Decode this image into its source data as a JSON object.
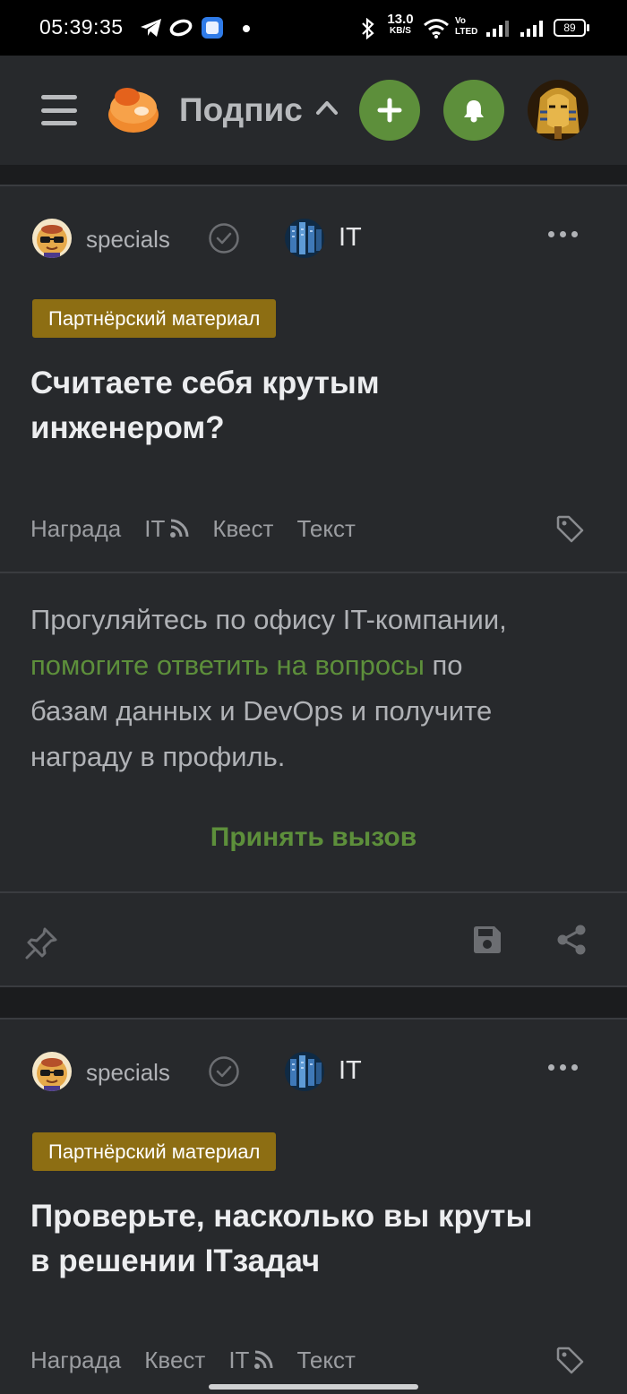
{
  "status_bar": {
    "time": "05:39:35",
    "net_speed_value": "13.0",
    "net_speed_unit": "KB/S",
    "volte": "Vo LTED",
    "battery": "89"
  },
  "header": {
    "title": "Подпис",
    "add_icon": "plus-icon",
    "notifications_icon": "bell-icon",
    "accent_color": "#5d8f3b"
  },
  "posts": [
    {
      "author": "specials",
      "community": "IT",
      "badge": "Партнёрский материал",
      "title_line1": "Считаете себя крутым",
      "title_line2": "инженером?",
      "tags": [
        "Награда",
        "IT",
        "Квест",
        "Текст"
      ],
      "body_start": "Прогуляйтесь по офису IT-компании,",
      "body_link": "помогите ответить на вопросы",
      "body_mid": " по",
      "body_line3": "базам данных и DevOps и получите",
      "body_line4": "награду в профиль.",
      "cta": "Принять вызов"
    },
    {
      "author": "specials",
      "community": "IT",
      "badge": "Партнёрский материал",
      "title_line1": "Проверьте, насколько вы круты",
      "title_line2": "в решении ITзадач",
      "tags": [
        "Награда",
        "Квест",
        "IT",
        "Текст"
      ]
    }
  ],
  "colors": {
    "badge": "#8d6e13",
    "card_bg": "#27292c",
    "page_bg": "#1b1c1e"
  }
}
